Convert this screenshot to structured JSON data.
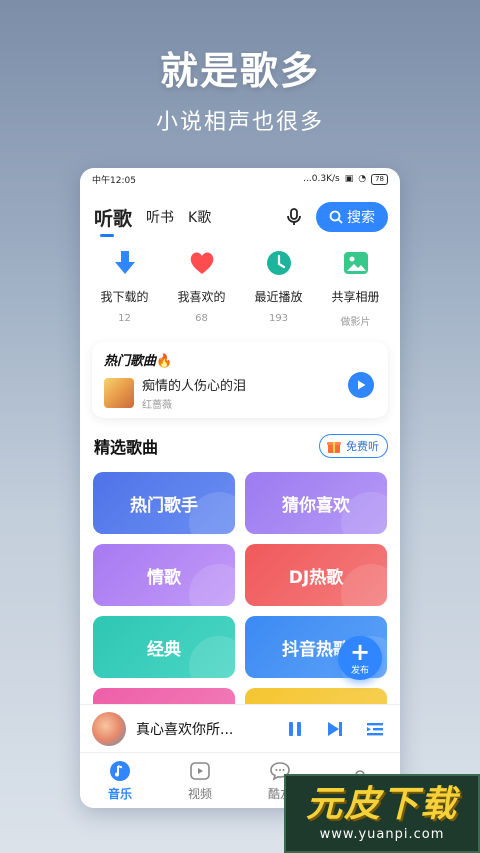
{
  "promo": {
    "title": "就是歌多",
    "subtitle": "小说相声也很多"
  },
  "statusbar": {
    "time": "中午12:05",
    "speed": "...0.3K/s",
    "battery": "78"
  },
  "topnav": {
    "tabs": [
      {
        "label": "听歌"
      },
      {
        "label": "听书"
      },
      {
        "label": "K歌"
      }
    ],
    "search_label": "搜索"
  },
  "quick_access": [
    {
      "label": "我下载的",
      "count": "12",
      "icon": "download-icon",
      "color": "#2f86ff"
    },
    {
      "label": "我喜欢的",
      "count": "68",
      "icon": "heart-icon",
      "color": "#ff4d4f"
    },
    {
      "label": "最近播放",
      "count": "193",
      "icon": "clock-icon",
      "color": "#1cb59b"
    },
    {
      "label": "共享相册",
      "count": "做影片",
      "icon": "photo-icon",
      "color": "#36c98b"
    }
  ],
  "hot_songs": {
    "title": "热门歌曲",
    "song": {
      "title": "痴情的人伤心的泪",
      "artist": "红蔷薇"
    }
  },
  "featured": {
    "title": "精选歌曲",
    "free_label": "免费听",
    "cards": [
      {
        "label": "热门歌手",
        "color_from": "#4f73e8",
        "color_to": "#6b8ff2"
      },
      {
        "label": "猜你喜欢",
        "color_from": "#9c7bf0",
        "color_to": "#b69af6"
      },
      {
        "label": "情歌",
        "color_from": "#a879f2",
        "color_to": "#c29bf7"
      },
      {
        "label": "DJ热歌",
        "color_from": "#f0595c",
        "color_to": "#f47c7c"
      },
      {
        "label": "经典",
        "color_from": "#2ec6b4",
        "color_to": "#4bd6c4"
      },
      {
        "label": "抖音热歌",
        "color_from": "#3b8af3",
        "color_to": "#5ea2f7"
      },
      {
        "label": "",
        "color_from": "#ee5fa8",
        "color_to": "#f27fbb"
      },
      {
        "label": "",
        "color_from": "#f5c531",
        "color_to": "#f7d25a"
      }
    ]
  },
  "fab": {
    "label": "发布"
  },
  "player": {
    "title": "真心喜欢你所..."
  },
  "tabbar": [
    {
      "label": "音乐",
      "icon": "music-icon"
    },
    {
      "label": "视频",
      "icon": "video-icon"
    },
    {
      "label": "酷友",
      "icon": "chat-icon"
    },
    {
      "label": "",
      "icon": "profile-icon"
    }
  ],
  "watermark": {
    "brand": "元皮下载",
    "url": "www.yuanpi.com"
  }
}
